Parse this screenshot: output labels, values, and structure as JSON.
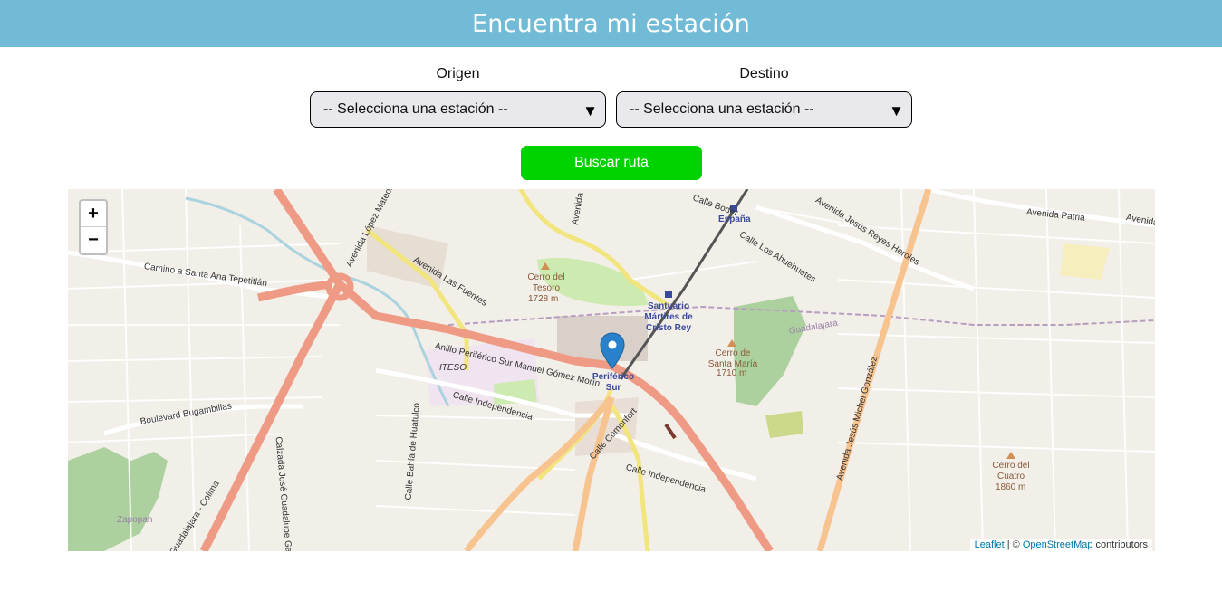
{
  "header": {
    "title": "Encuentra mi estación"
  },
  "origin": {
    "label": "Origen",
    "placeholder": "-- Selecciona una estación --"
  },
  "destination": {
    "label": "Destino",
    "placeholder": "-- Selecciona una estación --"
  },
  "search_button": {
    "label": "Buscar ruta"
  },
  "map": {
    "zoom_in": "+",
    "zoom_out": "−",
    "attribution": {
      "leaflet": "Leaflet",
      "separator": " | © ",
      "osm": "OpenStreetMap",
      "suffix": " contributors"
    },
    "marker": {
      "station": "Periférico Sur",
      "icon": "map-pin-icon",
      "color": "#2a81cb"
    },
    "labels": {
      "espana": "España",
      "santuario": "Santuario Mártires de Cristo Rey",
      "cerro_tesoro": "Cerro del Tesoro",
      "cerro_tesoro_alt": "1728 m",
      "cerro_santa_maria": "Cerro de Santa María",
      "cerro_santa_maria_alt": "1710 m",
      "cerro_cuatro": "Cerro del Cuatro",
      "cerro_cuatro_alt": "1860 m",
      "periferico": "Anillo Periférico Sur Manuel Gómez Morín",
      "av_lopez_mateos": "Avenida López Mateos",
      "av_las_fuentes": "Avenida Las Fuentes",
      "camino_santa_ana": "Camino a Santa Ana Tepetitlán",
      "blvd_bugambilias": "Boulevard Bugambilias",
      "calle_independencia": "Calle Independencia",
      "calle_independencia_2": "Calle Independencia",
      "calle_comonfort": "Calle Comonfort",
      "calzada_gallo": "Calzada José Guadalupe Gallo",
      "calle_bahia": "Calle Bahía de Huatulco",
      "av_patria": "Avenida Patria",
      "av_reyes_heroles": "Avenida Jesús Reyes Heroles",
      "av_michel": "Avenida Jesús Michel González",
      "calle_ahuehuetes": "Calle Los Ahuehuetes",
      "calle_boder": "Calle Boder",
      "iteso": "ITESO",
      "guadalajara": "Guadalajara",
      "zapopan": "Zapopan",
      "colima": "Guadalajara - Colima",
      "av_left": "Avenida",
      "avenida_top": "Avenida"
    }
  }
}
